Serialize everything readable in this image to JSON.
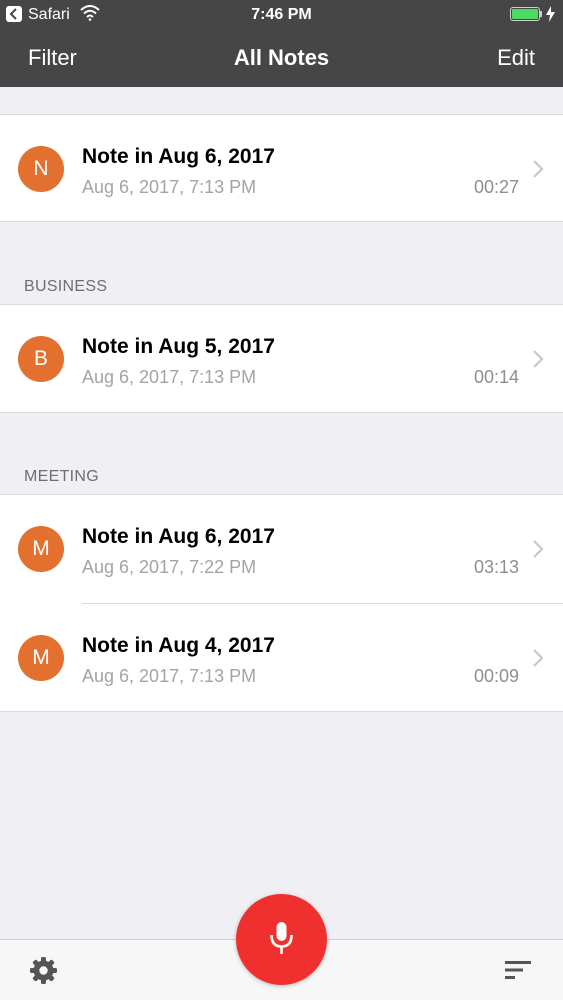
{
  "status_bar": {
    "back_app": "Safari",
    "time": "7:46 PM"
  },
  "nav": {
    "filter": "Filter",
    "title": "All Notes",
    "edit": "Edit"
  },
  "sections": [
    {
      "label": "",
      "notes": [
        {
          "initial": "N",
          "title": "Note in Aug 6, 2017",
          "date": "Aug 6, 2017, 7:13 PM",
          "duration": "00:27"
        }
      ]
    },
    {
      "label": "BUSINESS",
      "notes": [
        {
          "initial": "B",
          "title": "Note in Aug 5, 2017",
          "date": "Aug 6, 2017, 7:13 PM",
          "duration": "00:14"
        }
      ]
    },
    {
      "label": "MEETING",
      "notes": [
        {
          "initial": "M",
          "title": "Note in Aug 6, 2017",
          "date": "Aug 6, 2017, 7:22 PM",
          "duration": "03:13"
        },
        {
          "initial": "M",
          "title": "Note in Aug 4, 2017",
          "date": "Aug 6, 2017, 7:13 PM",
          "duration": "00:09"
        }
      ]
    }
  ],
  "toolbar": {
    "settings_icon": "gear-icon",
    "record_icon": "microphone-icon",
    "sort_icon": "sort-lines-icon"
  },
  "colors": {
    "header": "#464646",
    "avatar": "#e3702f",
    "record": "#f0302e",
    "battery": "#4cd964"
  }
}
